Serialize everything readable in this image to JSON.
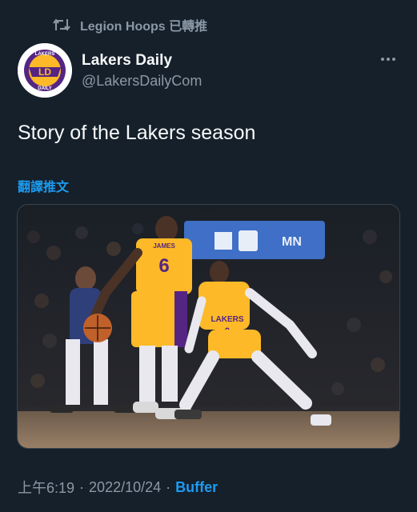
{
  "retweet": {
    "icon": "retweet-icon",
    "text": "Legion Hoops 已轉推"
  },
  "author": {
    "display_name": "Lakers Daily",
    "handle": "@LakersDailyCom",
    "avatar_icon": "lakers-daily-logo",
    "avatar_text_top": "LAKERS",
    "avatar_text_bottom": "DAILY"
  },
  "tweet": {
    "text": "Story of the Lakers season",
    "translate_label": "翻譯推文"
  },
  "media": {
    "icon": "basketball-photo",
    "arena_sign": "MN",
    "jersey_back_name": "JAMES",
    "jersey_back_number": "6",
    "jersey_front_team": "LAKERS",
    "jersey_front_number": "0"
  },
  "meta": {
    "time": "上午6:19",
    "separator": "·",
    "date": "2022/10/24",
    "source": "Buffer"
  },
  "colors": {
    "background": "#15202b",
    "accent": "#1d9bf0",
    "muted": "#8b98a5",
    "lakers_gold": "#fdb927",
    "lakers_purple": "#552583"
  }
}
